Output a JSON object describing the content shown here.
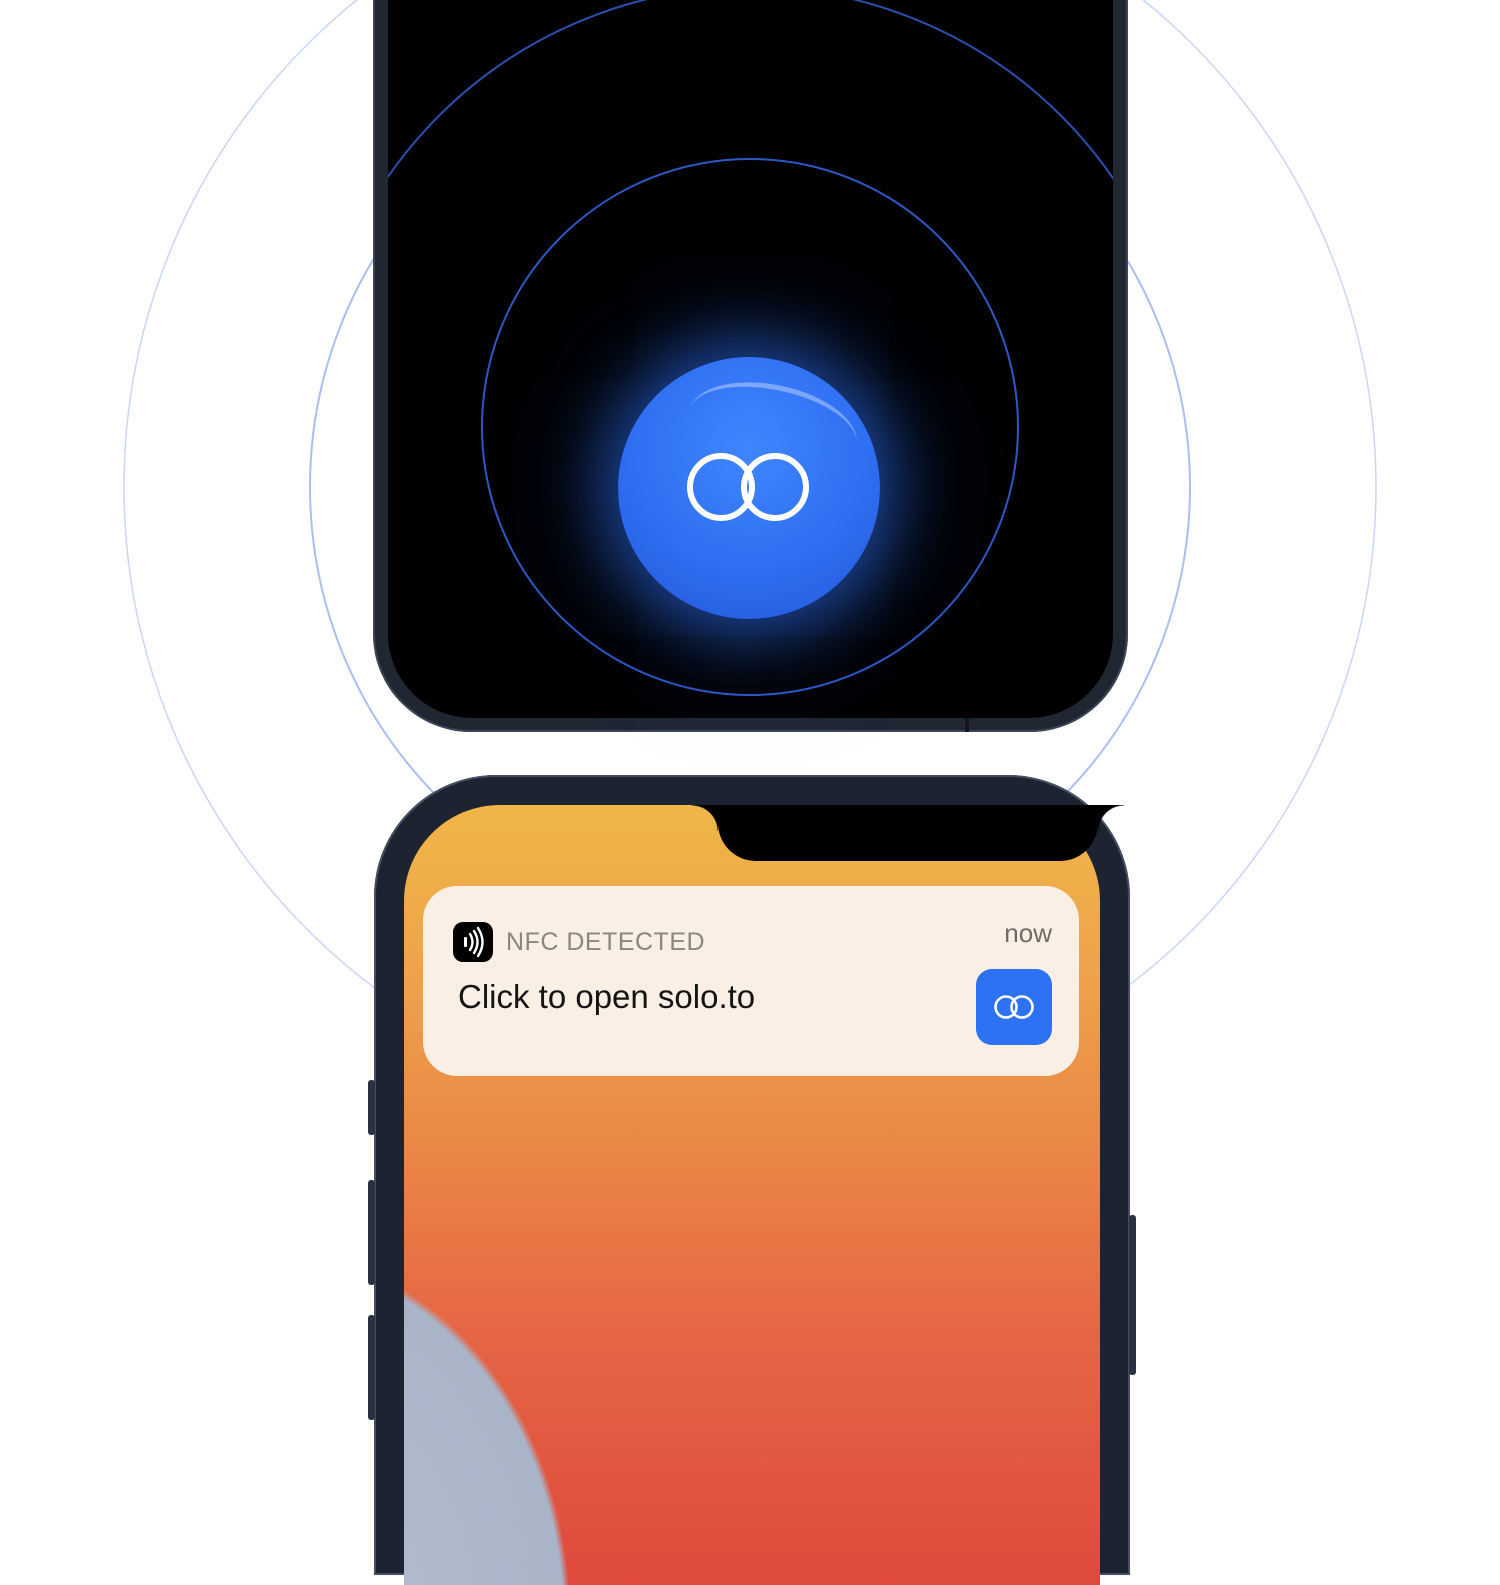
{
  "scene": {
    "tag_icon": "link-rings-icon",
    "accent_color": "#2f6ff2",
    "ring_color": "#5d8df0"
  },
  "notification": {
    "app_icon": "nfc-icon",
    "app_name": "NFC DETECTED",
    "time": "now",
    "message": "Click to open solo.to",
    "thumbnail_icon": "link-rings-icon",
    "thumbnail_color": "#2d72f3"
  }
}
